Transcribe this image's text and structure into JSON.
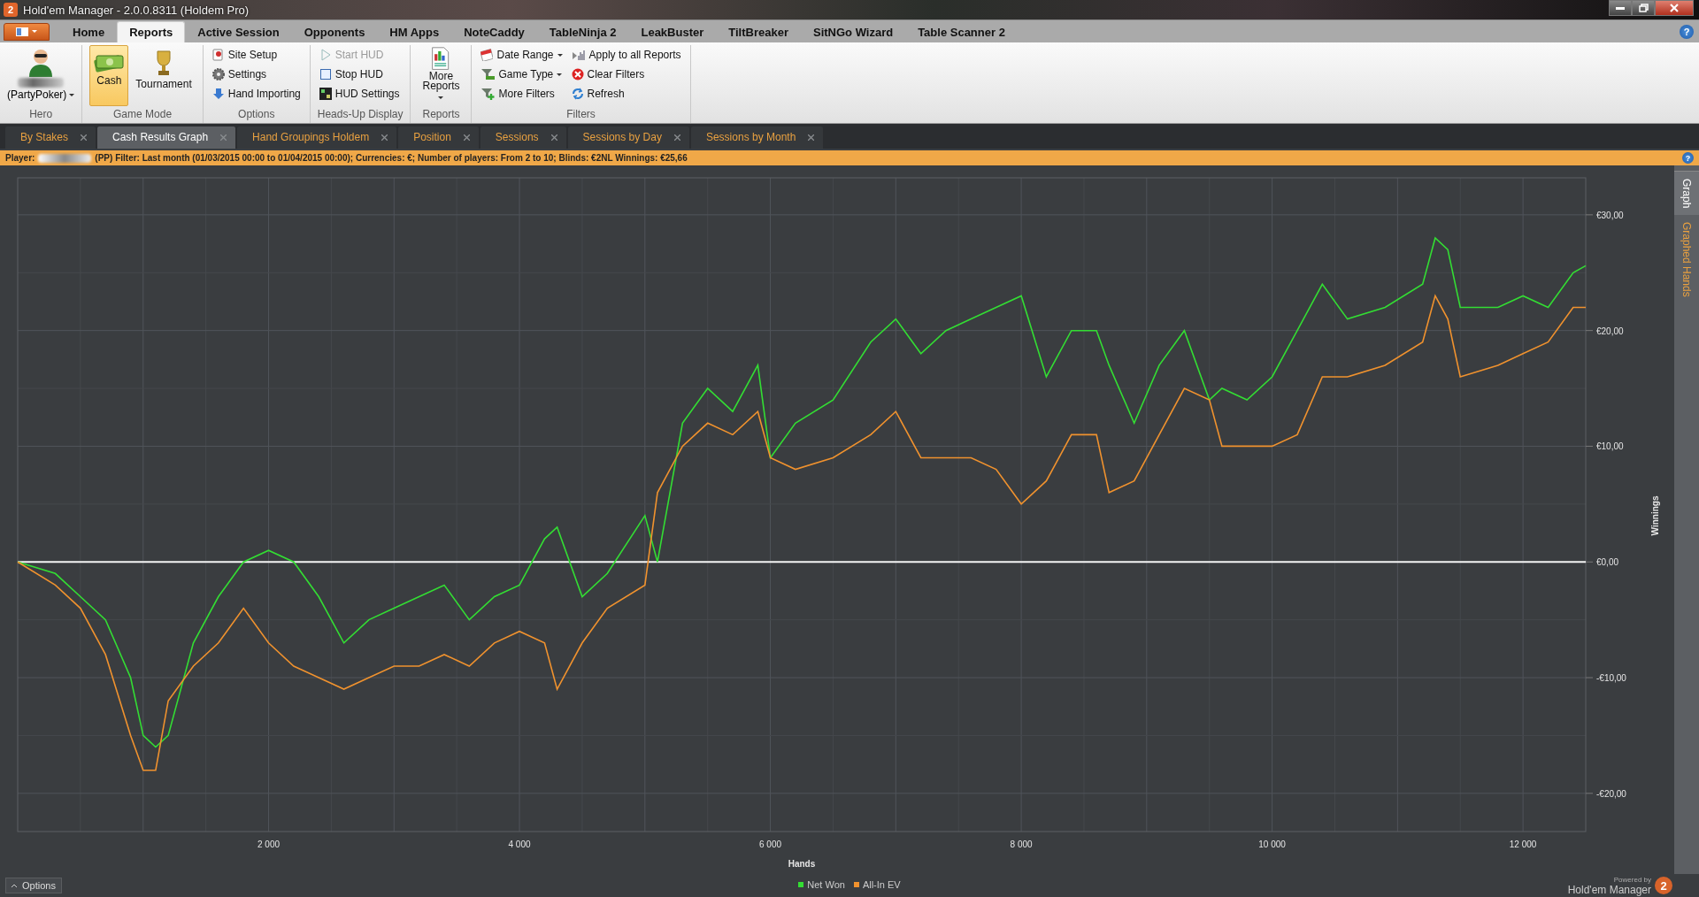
{
  "window": {
    "app_badge": "2",
    "title": "Hold'em Manager - 2.0.0.8311 (Holdem Pro)",
    "help_label": "?"
  },
  "menu_tabs": [
    {
      "label": "Home",
      "selected": false
    },
    {
      "label": "Reports",
      "selected": true
    },
    {
      "label": "Active Session",
      "selected": false
    },
    {
      "label": "Opponents",
      "selected": false
    },
    {
      "label": "HM Apps",
      "selected": false
    },
    {
      "label": "NoteCaddy",
      "selected": false
    },
    {
      "label": "TableNinja 2",
      "selected": false
    },
    {
      "label": "LeakBuster",
      "selected": false
    },
    {
      "label": "TiltBreaker",
      "selected": false
    },
    {
      "label": "SitNGo Wizard",
      "selected": false
    },
    {
      "label": "Table Scanner 2",
      "selected": false
    }
  ],
  "ribbon": {
    "groups": [
      {
        "label": "Hero",
        "items": [
          {
            "kind": "hero",
            "label": "(PartyPoker)",
            "dropdown": true
          }
        ]
      },
      {
        "label": "Game Mode",
        "items": [
          {
            "kind": "large",
            "label": "Cash",
            "selected": true
          },
          {
            "kind": "large",
            "label": "Tournament",
            "selected": false
          }
        ]
      },
      {
        "label": "Options",
        "items": [
          {
            "kind": "small",
            "label": "Site Setup"
          },
          {
            "kind": "small",
            "label": "Settings"
          },
          {
            "kind": "small",
            "label": "Hand Importing"
          }
        ]
      },
      {
        "label": "Heads-Up Display",
        "items": [
          {
            "kind": "small",
            "label": "Start HUD",
            "disabled": true
          },
          {
            "kind": "small",
            "label": "Stop HUD",
            "disabled": false
          },
          {
            "kind": "small",
            "label": "HUD Settings",
            "disabled": false
          }
        ]
      },
      {
        "label": "Reports",
        "items": [
          {
            "kind": "large",
            "label": "More Reports",
            "dropdown": true
          }
        ]
      },
      {
        "label": "Filters",
        "items": [
          {
            "kind": "small",
            "label": "Date Range",
            "dropdown": true
          },
          {
            "kind": "small",
            "label": "Game Type",
            "dropdown": true
          },
          {
            "kind": "small",
            "label": "More Filters",
            "dropdown": false
          },
          {
            "kind": "small",
            "label": "Apply to all Reports",
            "dropdown": false
          },
          {
            "kind": "small",
            "label": "Clear Filters",
            "dropdown": false
          },
          {
            "kind": "small",
            "label": "Refresh",
            "dropdown": false
          }
        ]
      }
    ]
  },
  "report_tabs": [
    {
      "label": "By Stakes",
      "selected": false
    },
    {
      "label": "Cash Results Graph",
      "selected": true
    },
    {
      "label": "Hand Groupings Holdem",
      "selected": false
    },
    {
      "label": "Position",
      "selected": false
    },
    {
      "label": "Sessions",
      "selected": false
    },
    {
      "label": "Sessions by Day",
      "selected": false
    },
    {
      "label": "Sessions by Month",
      "selected": false
    }
  ],
  "filter_bar": {
    "help_label": "?",
    "player_label": "Player:",
    "text": "(PP)  Filter:  Last month (01/03/2015 00:00 to 01/04/2015 00:00); Currencies: €; Number of players: From 2 to 10; Blinds: €2NL  Winnings:  €25,66"
  },
  "side_tabs": [
    {
      "label": "Graph",
      "selected": true
    },
    {
      "label": "Graphed Hands",
      "selected": false
    }
  ],
  "chart": {
    "chart_data": {
      "type": "line",
      "grid": true,
      "xlabel": "Hands",
      "ylabel": "Winnings",
      "xlim": [
        0,
        12500
      ],
      "ylim": [
        -23.3,
        33.2
      ],
      "xticks": [
        {
          "value": 2000,
          "label": "2 000"
        },
        {
          "value": 4000,
          "label": "4 000"
        },
        {
          "value": 6000,
          "label": "6 000"
        },
        {
          "value": 8000,
          "label": "8 000"
        },
        {
          "value": 10000,
          "label": "10 000"
        },
        {
          "value": 12000,
          "label": "12 000"
        }
      ],
      "yticks": [
        {
          "value": -20,
          "label": "-€20,00"
        },
        {
          "value": -10,
          "label": "-€10,00"
        },
        {
          "value": 0,
          "label": "€0,00"
        },
        {
          "value": 10,
          "label": "€10,00"
        },
        {
          "value": 20,
          "label": "€20,00"
        },
        {
          "value": 30,
          "label": "€30,00"
        }
      ],
      "x": [
        0,
        300,
        500,
        700,
        900,
        1000,
        1100,
        1200,
        1400,
        1600,
        1800,
        2000,
        2200,
        2400,
        2600,
        2800,
        3000,
        3200,
        3400,
        3600,
        3800,
        4000,
        4200,
        4300,
        4500,
        4700,
        5000,
        5100,
        5300,
        5500,
        5700,
        5900,
        6000,
        6200,
        6500,
        6800,
        7000,
        7200,
        7400,
        7600,
        7800,
        8000,
        8200,
        8400,
        8600,
        8700,
        8900,
        9100,
        9300,
        9500,
        9600,
        9800,
        10000,
        10200,
        10400,
        10600,
        10900,
        11200,
        11300,
        11400,
        11500,
        11800,
        12000,
        12200,
        12400,
        12500
      ],
      "series": [
        {
          "name": "Net Won",
          "color": "#33dd33",
          "values": [
            0,
            -1,
            -3,
            -5,
            -10,
            -15,
            -16,
            -15,
            -7,
            -3,
            0,
            1,
            0,
            -3,
            -7,
            -5,
            -4,
            -3,
            -2,
            -5,
            -3,
            -2,
            2,
            3,
            -3,
            -1,
            4,
            0,
            12,
            15,
            13,
            17,
            9,
            12,
            14,
            19,
            21,
            18,
            20,
            21,
            22,
            23,
            16,
            20,
            20,
            17,
            12,
            17,
            20,
            14,
            15,
            14,
            16,
            20,
            24,
            21,
            22,
            24,
            28,
            27,
            22,
            22,
            23,
            22,
            25,
            25.6
          ]
        },
        {
          "name": "All-In EV",
          "color": "#f0922e",
          "values": [
            0,
            -2,
            -4,
            -8,
            -15,
            -18,
            -18,
            -12,
            -9,
            -7,
            -4,
            -7,
            -9,
            -10,
            -11,
            -10,
            -9,
            -9,
            -8,
            -9,
            -7,
            -6,
            -7,
            -11,
            -7,
            -4,
            -2,
            6,
            10,
            12,
            11,
            13,
            9,
            8,
            9,
            11,
            13,
            9,
            9,
            9,
            8,
            5,
            7,
            11,
            11,
            6,
            7,
            11,
            15,
            14,
            10,
            10,
            10,
            11,
            16,
            16,
            17,
            19,
            23,
            21,
            16,
            17,
            18,
            19,
            22,
            22
          ]
        }
      ]
    }
  },
  "bottom_bar": {
    "options_label": "Options",
    "powered_by": "Powered by",
    "brand": "Hold'em Manager",
    "brand_badge": "2"
  }
}
